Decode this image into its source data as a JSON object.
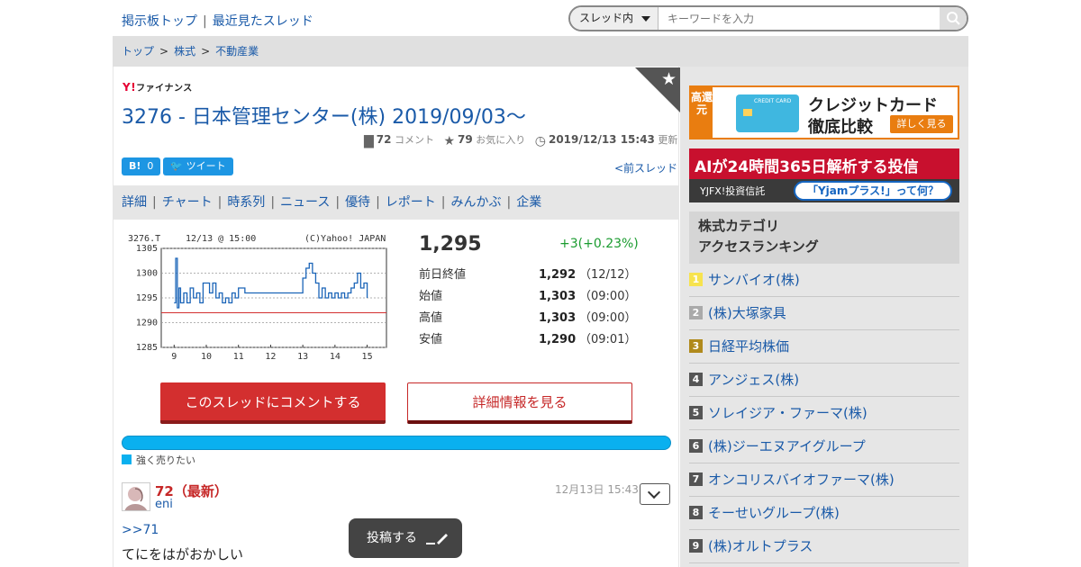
{
  "header": {
    "nav": [
      "掲示板トップ",
      "最近見たスレッド"
    ],
    "search": {
      "scope": "スレッド内",
      "placeholder": "キーワードを入力"
    }
  },
  "breadcrumb": [
    "トップ",
    "株式",
    "不動産業"
  ],
  "logo": "ファイナンス",
  "thread": {
    "title": "3276 - 日本管理センター(株) 2019/09/03〜",
    "comments_count": "72",
    "comments_label": "コメント",
    "favorites_count": "79",
    "favorites_label": "お気に入り",
    "updated_time": "2019/12/13 15:43",
    "updated_label": "更新",
    "hatena_count": "0",
    "tweet_label": "ツイート",
    "prev_label": "<前スレッド"
  },
  "tabs": [
    "詳細",
    "チャート",
    "時系列",
    "ニュース",
    "優待",
    "レポート",
    "みんかぶ",
    "企業"
  ],
  "chart_data": {
    "type": "line",
    "header_left": "3276.T",
    "header_mid": "12/13 @ 15:00",
    "header_right": "(C)Yahoo! JAPAN",
    "x_ticks": [
      "9",
      "10",
      "11",
      "12",
      "13",
      "14",
      "15"
    ],
    "y_ticks": [
      "1305",
      "1300",
      "1295",
      "1290",
      "1285"
    ],
    "ylim": [
      1285,
      1305
    ],
    "reference_line": 1292,
    "x": [
      9.0,
      9.05,
      9.1,
      9.15,
      9.2,
      9.3,
      9.4,
      9.5,
      9.6,
      9.7,
      9.8,
      9.9,
      10.0,
      10.1,
      10.2,
      10.3,
      10.4,
      10.5,
      10.6,
      10.7,
      10.8,
      10.9,
      11.0,
      11.2,
      11.5,
      11.8,
      12.5,
      13.0,
      13.1,
      13.2,
      13.3,
      13.4,
      13.5,
      13.6,
      13.7,
      13.8,
      13.9,
      14.0,
      14.1,
      14.2,
      14.3,
      14.4,
      14.5,
      14.6,
      14.7,
      14.8,
      14.9,
      15.0
    ],
    "y": [
      1294,
      1303,
      1293,
      1297,
      1294,
      1296,
      1294,
      1297,
      1295,
      1296,
      1294,
      1298,
      1298,
      1296,
      1298,
      1295,
      1296,
      1294,
      1295,
      1294,
      1296,
      1295,
      1297,
      1296,
      1296,
      1296,
      1296,
      1299,
      1301,
      1302,
      1300,
      1298,
      1295,
      1297,
      1295,
      1296,
      1295,
      1296,
      1295,
      1296,
      1295,
      1296,
      1297,
      1298,
      1300,
      1297,
      1298,
      1295
    ]
  },
  "price": {
    "current": "1,295",
    "change": "+3(+0.23%)",
    "rows": [
      {
        "label": "前日終値",
        "value": "1,292",
        "time": "（12/12）"
      },
      {
        "label": "始値",
        "value": "1,303",
        "time": "（09:00）"
      },
      {
        "label": "高値",
        "value": "1,303",
        "time": "（09:00）"
      },
      {
        "label": "安値",
        "value": "1,290",
        "time": "（09:01）"
      }
    ]
  },
  "actions": {
    "comment_btn": "このスレッドにコメントする",
    "detail_btn": "詳細情報を見る"
  },
  "sentiment": {
    "label": "強く売りたい",
    "share": 1.0
  },
  "comment": {
    "number": "72（最新）",
    "user": "eni",
    "date": "12月13日 15:43",
    "reply_to": ">>71",
    "text": "てにをはがおかしい"
  },
  "post_btn": "投稿する",
  "ads": {
    "ad1": {
      "tag": "高還元",
      "card_text": "CREDIT CARD",
      "line1": "クレジットカード",
      "line2": "徹底比較",
      "more": "詳しく見る"
    },
    "ad2": {
      "line1": "AIが24時間365日解析する投信",
      "brand": "YJFX!投資信託",
      "pill": "「Yjamプラス!」って何？"
    }
  },
  "ranking": {
    "title1": "株式カテゴリ",
    "title2": "アクセスランキング",
    "items": [
      {
        "rank": "1",
        "name": "サンバイオ(株)"
      },
      {
        "rank": "2",
        "name": "(株)大塚家具"
      },
      {
        "rank": "3",
        "name": "日経平均株価"
      },
      {
        "rank": "4",
        "name": "アンジェス(株)"
      },
      {
        "rank": "5",
        "name": "ソレイジア・ファーマ(株)"
      },
      {
        "rank": "6",
        "name": "(株)ジーエヌアイグループ"
      },
      {
        "rank": "7",
        "name": "オンコリスバイオファーマ(株)"
      },
      {
        "rank": "8",
        "name": "そーせいグループ(株)"
      },
      {
        "rank": "9",
        "name": "(株)オルトプラス"
      }
    ]
  }
}
